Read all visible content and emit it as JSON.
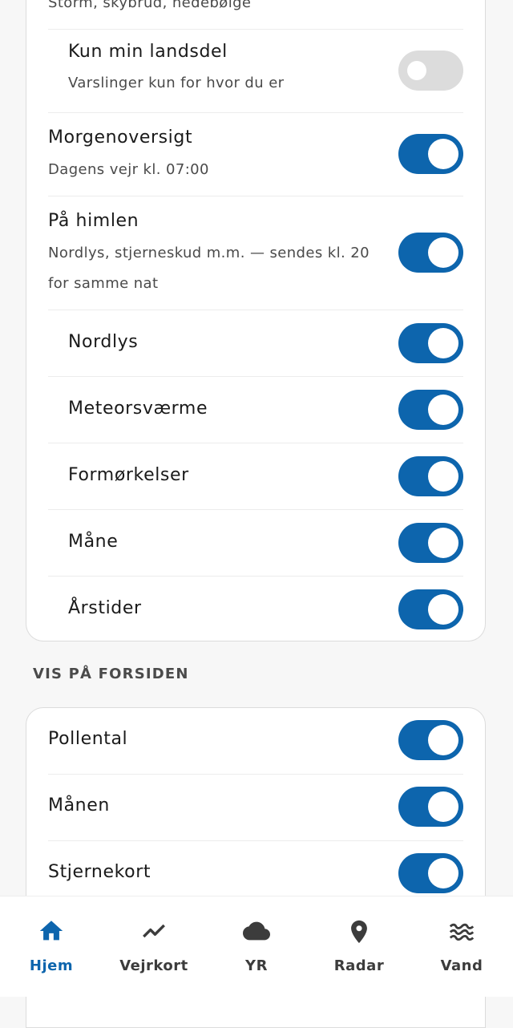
{
  "settings_card": {
    "top_sub": "Storm, skybrud, hedebølge",
    "rows": [
      {
        "title": "Kun min landsdel",
        "sub": "Varslinger kun for hvor du er",
        "on": false
      },
      {
        "title": "Morgenoversigt",
        "sub": "Dagens vejr kl. 07:00",
        "on": true
      },
      {
        "title": "På himlen",
        "sub": "Nordlys, stjerneskud m.m. — sendes kl. 20 for samme nat",
        "on": true
      },
      {
        "title": "Nordlys",
        "on": true
      },
      {
        "title": "Meteorsværme",
        "on": true
      },
      {
        "title": "Formørkelser",
        "on": true
      },
      {
        "title": "Måne",
        "on": true
      },
      {
        "title": "Årstider",
        "on": true
      }
    ]
  },
  "front_page": {
    "header": "VIS PÅ FORSIDEN",
    "rows": [
      {
        "title": "Pollental",
        "on": true
      },
      {
        "title": "Månen",
        "on": true
      },
      {
        "title": "Stjernekort",
        "on": true
      }
    ]
  },
  "bottom_nav": {
    "items": [
      {
        "label": "Hjem",
        "icon": "home-icon",
        "active": true
      },
      {
        "label": "Vejrkort",
        "icon": "trend-line-icon",
        "active": false
      },
      {
        "label": "YR",
        "icon": "cloud-icon",
        "active": false
      },
      {
        "label": "Radar",
        "icon": "location-pin-icon",
        "active": false
      },
      {
        "label": "Vand",
        "icon": "waves-icon",
        "active": false
      }
    ]
  },
  "colors": {
    "accent": "#0d65ad",
    "toggle_off": "#dcdcdc",
    "background": "#f7f7f7"
  }
}
